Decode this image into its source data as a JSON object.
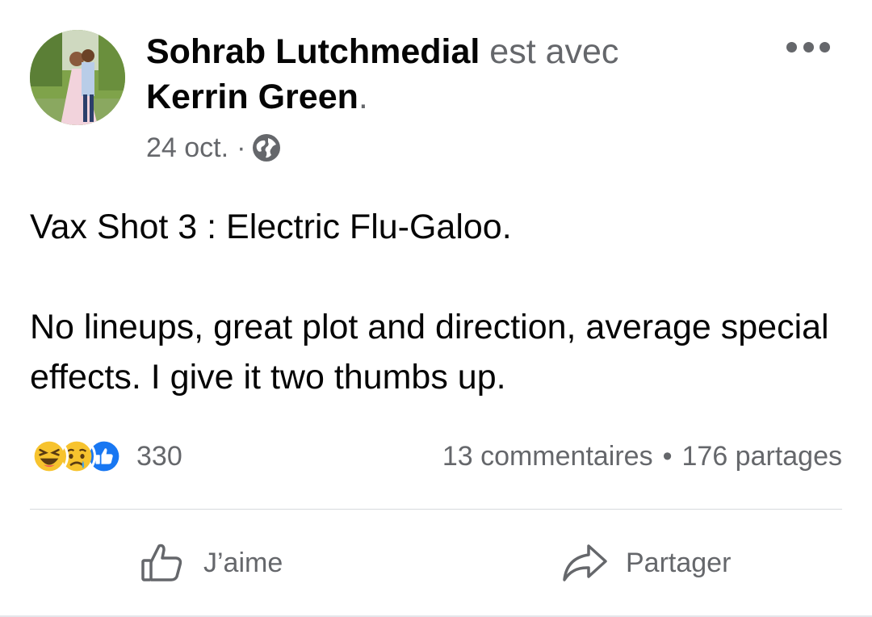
{
  "post": {
    "author": "Sohrab Lutchmedial",
    "with_text": "est avec",
    "tagged": "Kerrin Green",
    "period": ".",
    "date": "24 oct.",
    "date_separator": "·",
    "privacy_icon": "globe-icon",
    "more_icon": "more-options-icon",
    "body": [
      "Vax Shot 3 : Electric Flu-Galoo.",
      "No lineups, great plot and direction, average special effects. I give it two thumbs up."
    ]
  },
  "reactions": {
    "icons": [
      "haha-emoji",
      "sad-emoji",
      "like-emoji"
    ],
    "count": "330"
  },
  "stats": {
    "comments": "13 commentaires",
    "separator": "•",
    "shares": "176 partages"
  },
  "actions": {
    "like_label": "J’aime",
    "share_label": "Partager"
  },
  "colors": {
    "text_primary": "#050505",
    "text_secondary": "#65676b",
    "like_blue": "#1877f2",
    "emoji_yellow": "#f7c32e"
  }
}
